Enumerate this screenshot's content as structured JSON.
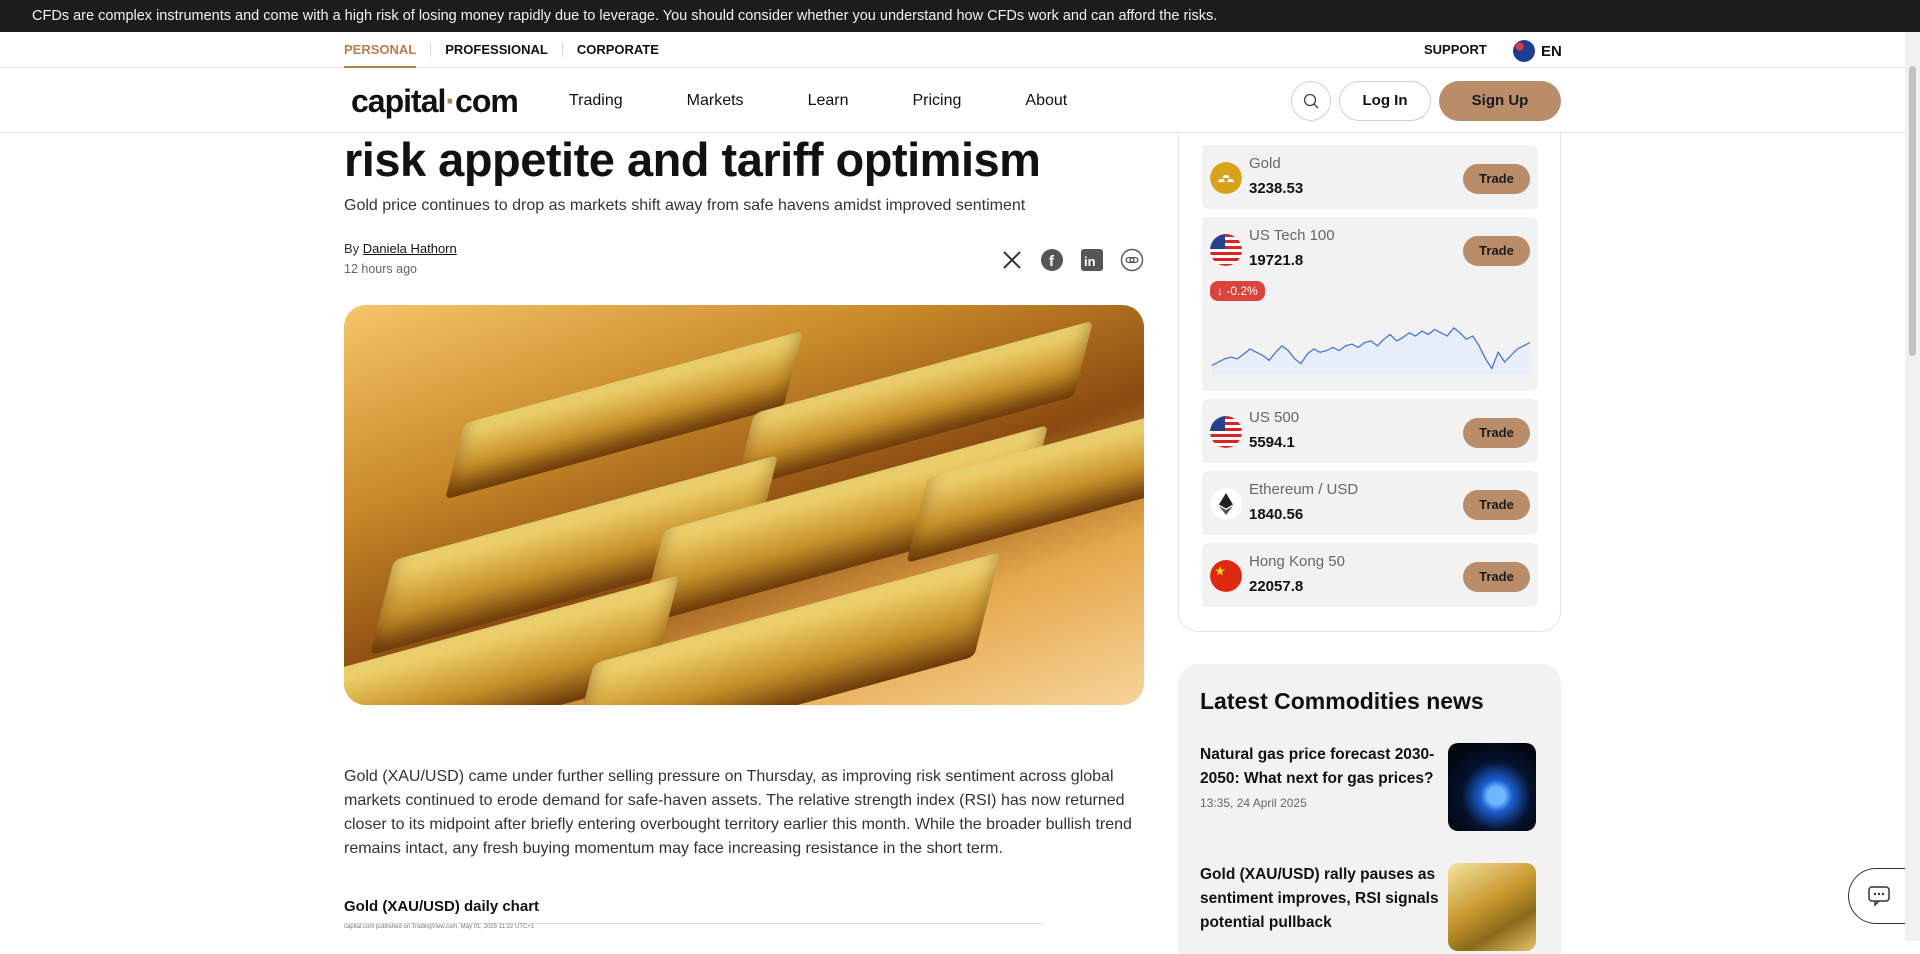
{
  "risk_warning": "CFDs are complex instruments and come with a high risk of losing money rapidly due to leverage. You should consider whether you understand how CFDs work and can afford the risks.",
  "segments": [
    "PERSONAL",
    "PROFESSIONAL",
    "CORPORATE"
  ],
  "support_label": "SUPPORT",
  "language": "EN",
  "logo": {
    "part1": "capital",
    "dot": "·",
    "part2": "com"
  },
  "menu": [
    "Trading",
    "Markets",
    "Learn",
    "Pricing",
    "About"
  ],
  "auth": {
    "login": "Log In",
    "signup": "Sign Up"
  },
  "article": {
    "headline": "risk appetite and tariff optimism",
    "subhead": "Gold price continues to drop as markets shift away from safe havens amidst improved sentiment",
    "by": "By",
    "author": "Daniela Hathorn",
    "time": "12 hours ago",
    "body": "Gold (XAU/USD) came under further selling pressure on Thursday, as improving risk sentiment across global markets continued to erode demand for safe-haven assets. The relative strength index (RSI) has now returned closer to its midpoint after briefly entering overbought territory earlier this month. While the broader bullish trend remains intact, any fresh buying momentum may face increasing resistance in the short term.",
    "chart_title": "Gold (XAU/USD) daily chart",
    "chart_caption": "capital.com published on TradingView.com, May 01, 2025 11:22 UTC+1"
  },
  "markets": [
    {
      "name": "Gold",
      "price": "3238.53",
      "trade": "Trade",
      "icon": "gold-bars-icon",
      "color": "#d9a21b"
    },
    {
      "name": "US Tech 100",
      "price": "19721.8",
      "trade": "Trade",
      "icon": "us-flag-icon",
      "change": "↓ -0.2%"
    },
    {
      "name": "US 500",
      "price": "5594.1",
      "trade": "Trade",
      "icon": "us-flag-icon"
    },
    {
      "name": "Ethereum / USD",
      "price": "1840.56",
      "trade": "Trade",
      "icon": "ethereum-icon"
    },
    {
      "name": "Hong Kong 50",
      "price": "22057.8",
      "trade": "Trade",
      "icon": "china-flag-icon"
    }
  ],
  "sparkline": [
    26,
    24,
    22,
    21,
    22,
    19,
    16,
    18,
    20,
    23,
    18,
    14,
    17,
    22,
    25,
    19,
    16,
    18,
    17,
    15,
    17,
    14,
    13,
    15,
    12,
    11,
    14,
    10,
    7,
    11,
    9,
    6,
    8,
    5,
    7,
    4,
    6,
    8,
    3,
    6,
    10,
    8,
    14,
    22,
    28,
    18,
    24,
    20,
    16,
    14,
    12
  ],
  "news": {
    "title": "Latest Commodities news",
    "items": [
      {
        "headline": "Natural gas price forecast 2030-2050: What next for gas prices?",
        "meta": "13:35, 24 April 2025"
      },
      {
        "headline": "Gold (XAU/USD) rally pauses as sentiment improves, RSI signals potential pullback",
        "meta": ""
      }
    ]
  }
}
